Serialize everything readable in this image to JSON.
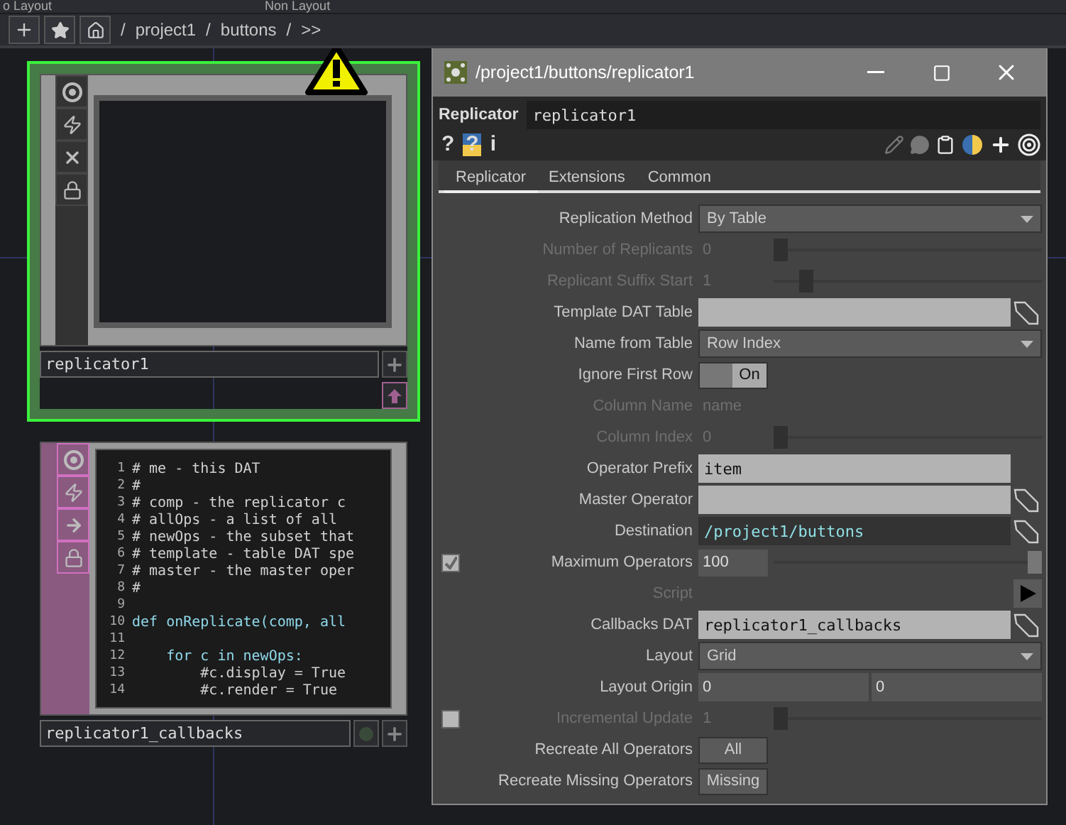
{
  "top_strip": {
    "labels": [
      "o Layout",
      "Non Layout"
    ]
  },
  "path_bar": {
    "segments": [
      {
        "separator": "/",
        "label": "project1"
      },
      {
        "separator": "/",
        "label": "buttons"
      },
      {
        "separator": "/",
        "label": ">>"
      }
    ]
  },
  "nodes": [
    {
      "kind": "comp",
      "name": "replicator1",
      "selected": true,
      "warning": true
    },
    {
      "kind": "dat",
      "name": "replicator1_callbacks",
      "selected": false,
      "warning": false,
      "lines": [
        {
          "number": "1",
          "text": "# me - this DAT",
          "kind": "comment"
        },
        {
          "number": "2",
          "text": "#",
          "kind": "comment"
        },
        {
          "number": "3",
          "text": "# comp - the replicator c",
          "kind": "comment"
        },
        {
          "number": "4",
          "text": "# allOps - a list of all",
          "kind": "comment"
        },
        {
          "number": "5",
          "text": "# newOps - the subset that",
          "kind": "comment"
        },
        {
          "number": "6",
          "text": "# template - table DAT spe",
          "kind": "comment"
        },
        {
          "number": "7",
          "text": "# master - the master oper",
          "kind": "comment"
        },
        {
          "number": "8",
          "text": "#",
          "kind": "comment"
        },
        {
          "number": "9",
          "kind": "blank"
        },
        {
          "number": "10",
          "text": "def onReplicate(comp, all",
          "kind": "code"
        },
        {
          "number": "11",
          "kind": "blank"
        },
        {
          "number": "12",
          "text": "    for c in newOps:",
          "kind": "code"
        },
        {
          "number": "13",
          "text": "        #c.display = True",
          "kind": "comment"
        },
        {
          "number": "14",
          "text": "        #c.render = True",
          "kind": "comment"
        }
      ]
    }
  ],
  "window": {
    "title": "/project1/buttons/replicator1",
    "op_type": "Replicator",
    "op_name": "replicator1",
    "help_buttons": [
      "?",
      "?",
      "i"
    ],
    "tabs": [
      {
        "label": "Replicator",
        "selected": true
      },
      {
        "label": "Extensions",
        "selected": false
      },
      {
        "label": "Common",
        "selected": false
      }
    ],
    "params": [
      {
        "kind": "menu",
        "label": "Replication Method",
        "value": "By Table",
        "disabled": false
      },
      {
        "kind": "slider",
        "label": "Number of Replicants",
        "value": "0",
        "level": 0,
        "disabled": true
      },
      {
        "kind": "slider",
        "label": "Replicant Suffix Start",
        "value": "1",
        "level": 0.1,
        "disabled": true
      },
      {
        "kind": "field",
        "label": "Template DAT Table",
        "disabled": false,
        "reference": true
      },
      {
        "kind": "menu",
        "label": "Name from Table",
        "value": "Row Index",
        "disabled": false
      },
      {
        "kind": "toggle",
        "label": "Ignore First Row",
        "value": "On",
        "on": true,
        "disabled": false
      },
      {
        "kind": "text",
        "label": "Column Name",
        "value": "name",
        "disabled": true
      },
      {
        "kind": "slider",
        "label": "Column Index",
        "value": "0",
        "level": 0,
        "disabled": true
      },
      {
        "kind": "field",
        "label": "Operator Prefix",
        "value": "item",
        "disabled": false,
        "reference": false
      },
      {
        "kind": "field",
        "label": "Master Operator",
        "disabled": false,
        "reference": true
      },
      {
        "kind": "path",
        "label": "Destination",
        "value": "/project1/buttons",
        "disabled": false,
        "reference": true
      },
      {
        "kind": "slider",
        "label": "Maximum Operators",
        "value": "100",
        "level": 1,
        "disabled": false,
        "checked": true
      },
      {
        "kind": "pulse",
        "label": "Script",
        "disabled": true
      },
      {
        "kind": "field",
        "label": "Callbacks DAT",
        "value": "replicator1_callbacks",
        "disabled": false,
        "reference": true
      },
      {
        "kind": "menu",
        "label": "Layout",
        "value": "Grid",
        "disabled": false
      },
      {
        "kind": "xy",
        "label": "Layout Origin",
        "values": [
          "0",
          "0"
        ],
        "disabled": false
      },
      {
        "kind": "slider",
        "label": "Incremental Update",
        "value": "1",
        "level": 0,
        "disabled": true,
        "checked": false
      },
      {
        "kind": "button",
        "label": "Recreate All Operators",
        "value": "All",
        "disabled": false
      },
      {
        "kind": "button",
        "label": "Recreate Missing Operators",
        "value": "Missing",
        "disabled": false
      }
    ]
  }
}
